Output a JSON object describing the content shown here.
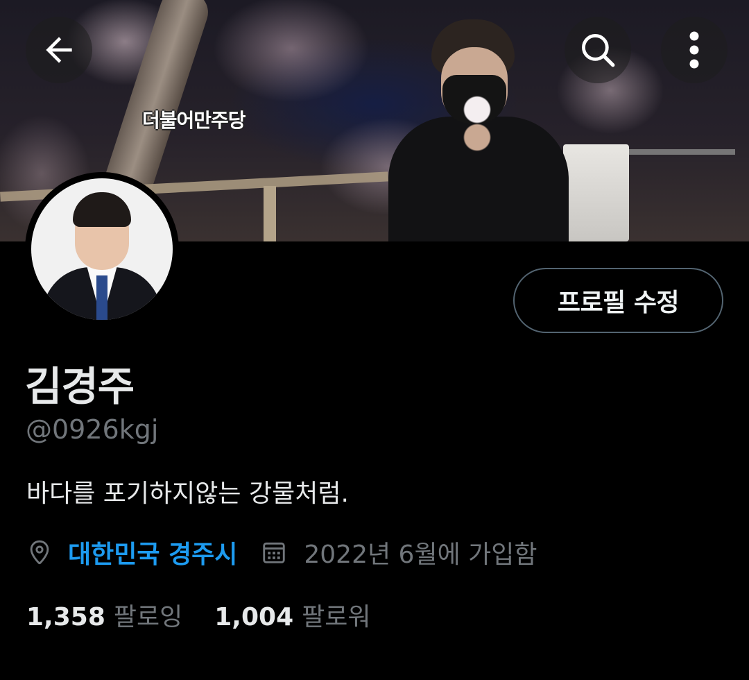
{
  "header": {
    "banner_caption": "더불어만주당",
    "back_icon": "arrow-left-icon",
    "search_icon": "search-icon",
    "more_icon": "more-vertical-icon"
  },
  "profile": {
    "edit_button_label": "프로필 수정",
    "display_name": "김경주",
    "handle": "@0926kgj",
    "bio": "바다를 포기하지않는 강물처럼.",
    "location": "대한민국 경주시",
    "joined": "2022년 6월에 가입함",
    "following_count": "1,358",
    "following_label": "팔로잉",
    "followers_count": "1,004",
    "followers_label": "팔로워"
  },
  "colors": {
    "background": "#000000",
    "text_primary": "#e7e9ea",
    "text_secondary": "#71767b",
    "link": "#1d9bf0",
    "button_border": "#536471"
  }
}
